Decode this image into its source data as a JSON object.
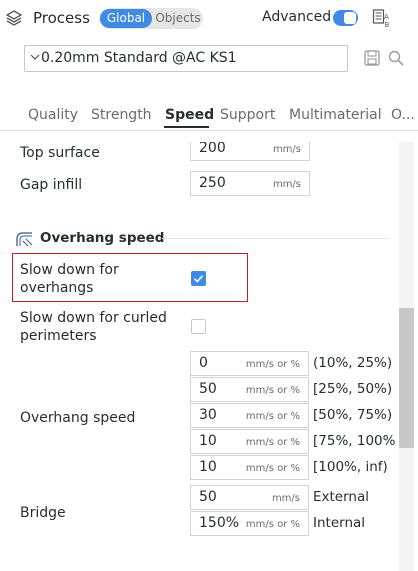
{
  "header": {
    "title": "Process",
    "seg_global": "Global",
    "seg_objects": "Objects",
    "advanced_label": "Advanced",
    "advanced_on": true
  },
  "preset": {
    "value": "0.20mm Standard @AC KS1"
  },
  "tabs": [
    "Quality",
    "Strength",
    "Speed",
    "Support",
    "Multimaterial",
    "O..."
  ],
  "active_tab": "Speed",
  "content": {
    "partial_top": {
      "label": "Top surface",
      "value": "200",
      "unit": "mm/s"
    },
    "gap_infill": {
      "label": "Gap infill",
      "value": "250",
      "unit": "mm/s"
    },
    "section_title": "Overhang speed",
    "slow_overhangs": {
      "label_1": "Slow down for",
      "label_2": "overhangs",
      "checked": true
    },
    "slow_curled": {
      "label_1": "Slow down for curled",
      "label_2": "perimeters",
      "checked": false
    },
    "overhang_speed": {
      "label": "Overhang speed",
      "rows": [
        {
          "value": "0",
          "unit": "mm/s or %",
          "range": "(10%, 25%)"
        },
        {
          "value": "50",
          "unit": "mm/s or %",
          "range": "[25%, 50%)"
        },
        {
          "value": "30",
          "unit": "mm/s or %",
          "range": "[50%, 75%)"
        },
        {
          "value": "10",
          "unit": "mm/s or %",
          "range": "[75%, 100%"
        },
        {
          "value": "10",
          "unit": "mm/s or %",
          "range": "[100%, inf)"
        }
      ]
    },
    "bridge": {
      "label": "Bridge",
      "external": {
        "value": "50",
        "unit": "mm/s",
        "suffix": "External"
      },
      "internal": {
        "value": "150%",
        "unit": "mm/s or %",
        "suffix": "Internal"
      }
    }
  },
  "colors": {
    "accent": "#3f8be3",
    "highlight_border": "#c41e24",
    "text": "#262e30"
  },
  "icons": [
    "layers-icon",
    "compare-icon",
    "chevron-down-icon",
    "save-icon",
    "search-icon",
    "overhang-section-icon",
    "checkmark-icon"
  ]
}
